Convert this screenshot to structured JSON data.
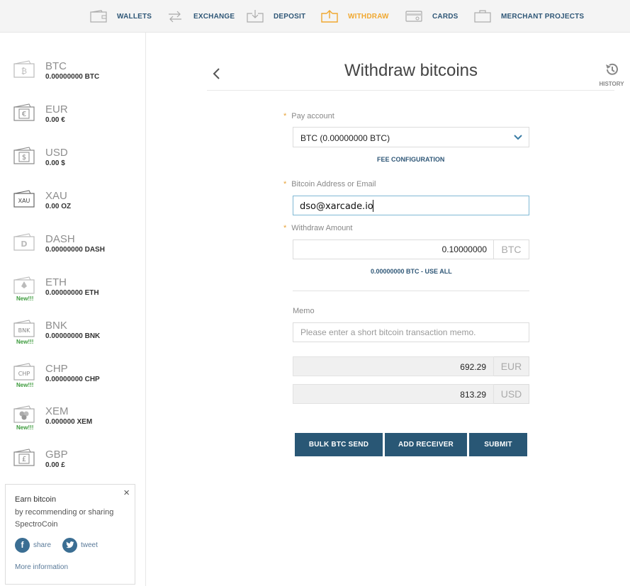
{
  "nav": {
    "items": [
      {
        "label": "WALLETS",
        "icon": "wallet-icon"
      },
      {
        "label": "EXCHANGE",
        "icon": "exchange-icon"
      },
      {
        "label": "DEPOSIT",
        "icon": "deposit-icon"
      },
      {
        "label": "WITHDRAW",
        "icon": "withdraw-icon",
        "active": true
      },
      {
        "label": "CARDS",
        "icon": "card-icon"
      },
      {
        "label": "MERCHANT PROJECTS",
        "icon": "briefcase-icon"
      }
    ]
  },
  "sidebar": {
    "wallets": [
      {
        "code": "BTC",
        "balance": "0.00000000 BTC",
        "icon_glyph": "₿",
        "new": ""
      },
      {
        "code": "EUR",
        "balance": "0.00 €",
        "icon_glyph": "€",
        "new": ""
      },
      {
        "code": "USD",
        "balance": "0.00 $",
        "icon_glyph": "$",
        "new": ""
      },
      {
        "code": "XAU",
        "balance": "0.00 OZ",
        "icon_glyph": "XAU",
        "new": ""
      },
      {
        "code": "DASH",
        "balance": "0.00000000 DASH",
        "icon_glyph": "D",
        "new": ""
      },
      {
        "code": "ETH",
        "balance": "0.00000000 ETH",
        "icon_glyph": "◆",
        "new": "New!!!"
      },
      {
        "code": "BNK",
        "balance": "0.00000000 BNK",
        "icon_glyph": "BNK",
        "new": "New!!!"
      },
      {
        "code": "CHP",
        "balance": "0.00000000 CHP",
        "icon_glyph": "CHP",
        "new": "New!!!"
      },
      {
        "code": "XEM",
        "balance": "0.000000 XEM",
        "icon_glyph": "✿",
        "new": "New!!!"
      },
      {
        "code": "GBP",
        "balance": "0.00 £",
        "icon_glyph": "£",
        "new": ""
      }
    ],
    "promo": {
      "title": "Earn bitcoin",
      "text": "by recommending or sharing SpectroCoin",
      "close": "×",
      "share": "share",
      "tweet": "tweet",
      "more": "More information"
    }
  },
  "main": {
    "title": "Withdraw bitcoins",
    "history": "HISTORY",
    "pay_account": {
      "label": "Pay account",
      "value": "BTC (0.00000000 BTC)"
    },
    "fee_link": "FEE CONFIGURATION",
    "address": {
      "label": "Bitcoin Address or Email",
      "value": "dso@xarcade.io"
    },
    "amount": {
      "label": "Withdraw Amount",
      "value": "0.10000000",
      "unit": "BTC"
    },
    "use_all": "0.00000000 BTC - USE ALL",
    "memo": {
      "label": "Memo",
      "placeholder": "Please enter a short bitcoin transaction memo."
    },
    "conversions": [
      {
        "value": "692.29",
        "unit": "EUR"
      },
      {
        "value": "813.29",
        "unit": "USD"
      }
    ],
    "buttons": {
      "bulk": "BULK BTC SEND",
      "add": "ADD RECEIVER",
      "submit": "SUBMIT"
    }
  },
  "colors": {
    "accent": "#f0a830",
    "primary": "#295775",
    "new_badge": "#3b9a3b"
  }
}
